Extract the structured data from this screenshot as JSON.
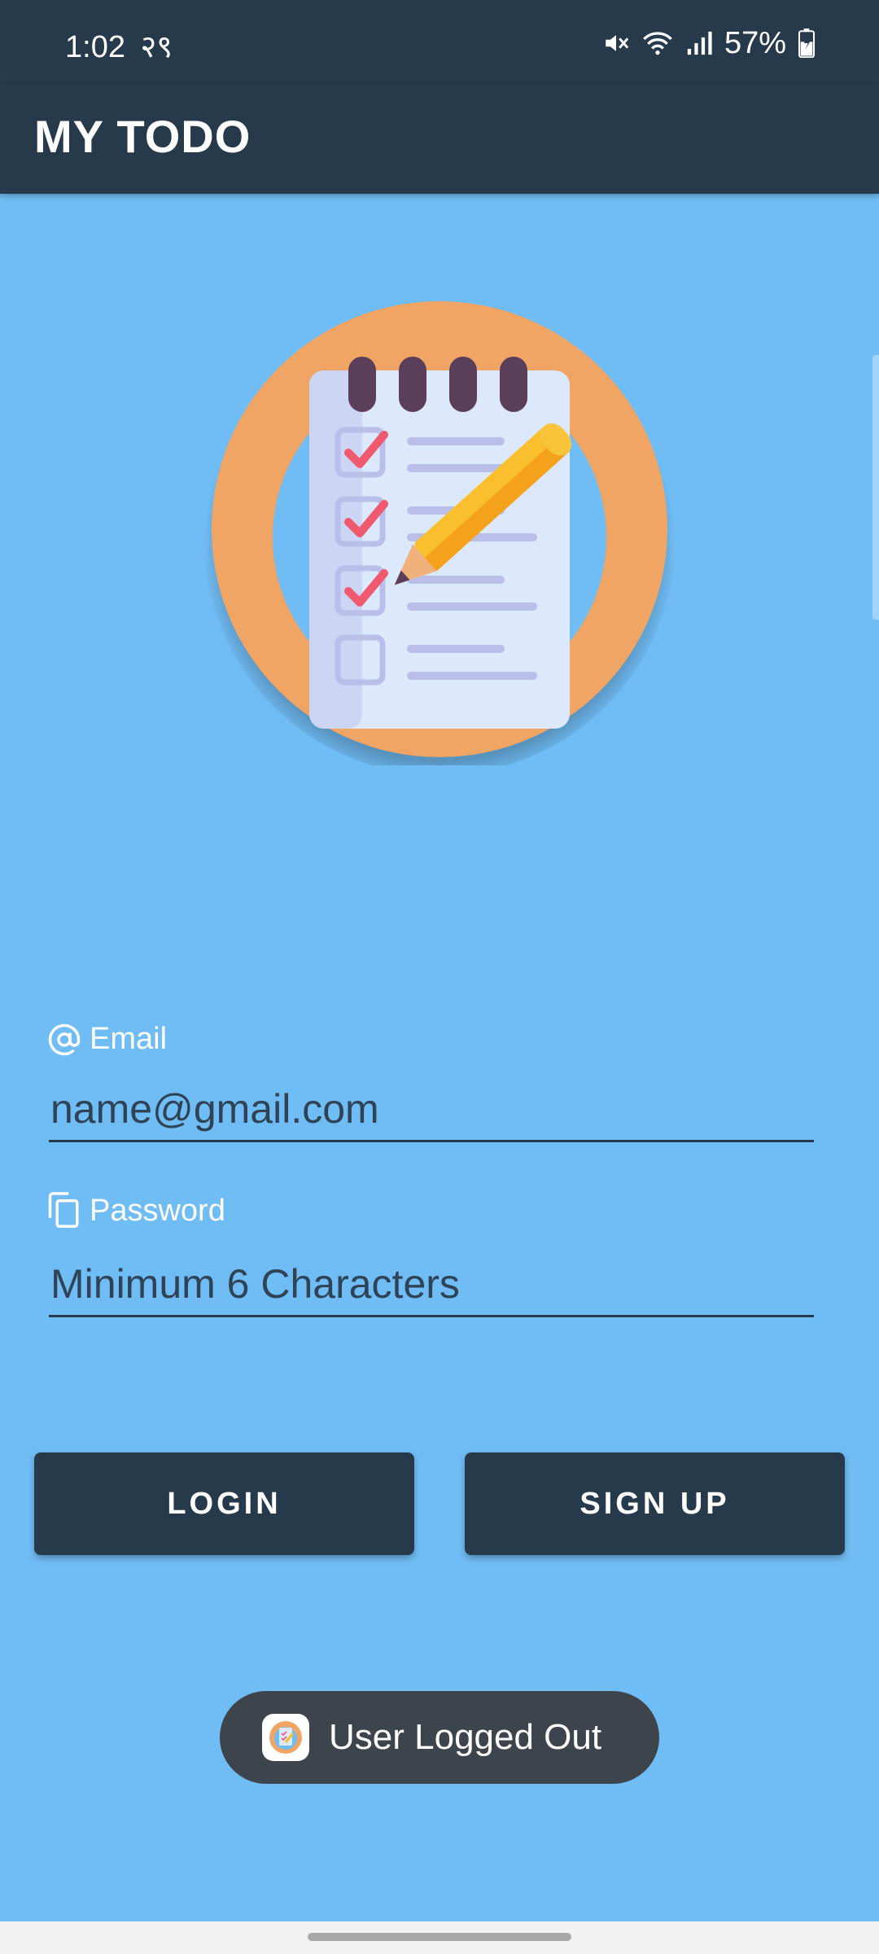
{
  "status_bar": {
    "time": "1:02",
    "extra": "२९",
    "battery": "57%",
    "icons": [
      "mute-icon",
      "wifi-icon",
      "signal-icon",
      "battery-icon"
    ]
  },
  "app_bar": {
    "title": "MY TODO"
  },
  "logo": {
    "icon": "todo-checklist-logo"
  },
  "email": {
    "label": "Email",
    "icon": "at-sign-icon",
    "placeholder": "name@gmail.com",
    "value": ""
  },
  "password": {
    "label": "Password",
    "icon": "copy-icon",
    "placeholder": "Minimum 6 Characters",
    "value": ""
  },
  "buttons": {
    "login": "LOGIN",
    "signup": "SIGN UP"
  },
  "toast": {
    "text": "User Logged Out",
    "icon": "app-icon"
  },
  "colors": {
    "background": "#70bcf4",
    "primary_dark": "#263a4b",
    "logo_ring": "#f0a564",
    "toast_bg": "#3d444b"
  }
}
